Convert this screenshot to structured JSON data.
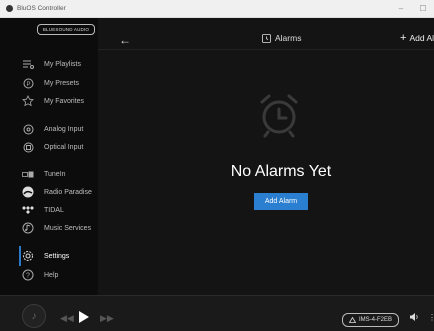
{
  "window": {
    "title": "BluOS Controller",
    "minimize": "–",
    "maximize": "☐"
  },
  "brand": {
    "text": "BLUESOUND AUDIO"
  },
  "nav": {
    "my_playlists": "My Playlists",
    "my_presets": "My Presets",
    "my_favorites": "My Favorites",
    "analog_input": "Analog Input",
    "optical_input": "Optical Input",
    "tunein": "TuneIn",
    "radio_paradise": "Radio Paradise",
    "tidal": "TIDAL",
    "music_services": "Music Services",
    "settings": "Settings",
    "help": "Help"
  },
  "header": {
    "title": "Alarms",
    "add_label": "Add Ala",
    "back": "←"
  },
  "empty": {
    "message": "No Alarms Yet",
    "button": "Add Alarm"
  },
  "player": {
    "device": "IMS-4-F2EB",
    "prev": "◀◀",
    "next": "▶▶"
  },
  "colors": {
    "accent": "#2a7fd0",
    "sidebar": "#0c0c0c",
    "main": "#141414"
  }
}
